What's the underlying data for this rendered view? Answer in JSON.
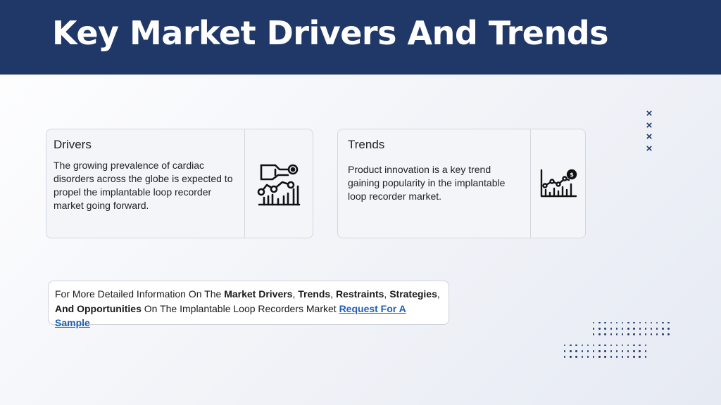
{
  "slide": {
    "title": "Key Market Drivers And Trends"
  },
  "drivers": {
    "title": "Drivers",
    "body": "The growing prevalence of cardiac disorders across the globe is expected to propel the implantable loop recorder market going forward.",
    "icon": "hand-chart-icon"
  },
  "trends": {
    "title": "Trends",
    "body": "Product innovation is a key trend gaining popularity in the implantable loop recorder market.",
    "icon": "growth-chart-dollar-icon"
  },
  "info": {
    "t1": "For More Detailed Information On The ",
    "b1": "Market Drivers",
    "t2": ", ",
    "b2": "Trends",
    "t3": ", ",
    "b3": "Restraints",
    "t4": ", ",
    "b4": "Strategies",
    "t5": ", ",
    "b5": "And Opportunities",
    "t6": " On The Implantable Loop Recorders Market  ",
    "link": "Request For A Sample"
  },
  "decor": {
    "x_marks": [
      "×",
      "×",
      "×",
      "×"
    ],
    "accent_color": "#1f3868",
    "link_color": "#1f5fb4"
  }
}
